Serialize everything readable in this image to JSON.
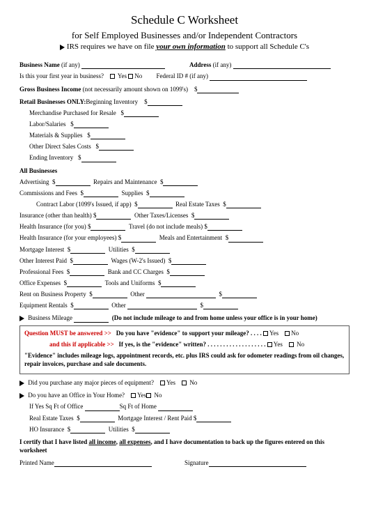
{
  "header": {
    "title": "Schedule C Worksheet",
    "subtitle": "for Self Employed Businesses and/or Independent Contractors",
    "irs_pre": "IRS requires we have on file ",
    "irs_emph": "your own information",
    "irs_post": " to support all Schedule C's"
  },
  "labels": {
    "business_name": "Business Name",
    "if_any": " (if any)",
    "address": "Address",
    "first_year": "Is this your first year in business?",
    "yes": "Yes",
    "no": "No",
    "federal_id": "Federal ID # (if any)",
    "gross_income": "Gross Business Income",
    "gross_income_note": " (not necessarily amount shown on 1099's)",
    "retail_only": "Retail Businesses ONLY:",
    "beginning_inv": "Beginning Inventory",
    "merch_resale": "Merchandise Purchased for Resale",
    "labor_salaries": "Labor/Salaries",
    "materials_supplies": "Materials & Supplies",
    "other_direct": "Other Direct Sales Costs",
    "ending_inv": "Ending Inventory",
    "all_businesses": "All Businesses",
    "advertising": "Advertising",
    "repairs": "Repairs and Maintenance",
    "commissions": "Commissions and Fees",
    "supplies": "Supplies",
    "contract_labor": "Contract Labor (1099's Issued, if app)",
    "real_estate_taxes": "Real Estate Taxes",
    "insurance_other": "Insurance (other than health)",
    "other_taxes": "Other Taxes/Licenses",
    "health_ins_you": "Health Insurance (for you)",
    "travel": "Travel (do not include meals)",
    "health_ins_emp": "Health Insurance (for your employees)",
    "meals_ent": "Meals and Entertainment",
    "mortgage_interest": "Mortgage Interest",
    "utilities": "Utilities",
    "other_interest": "Other Interest Paid",
    "wages": "Wages (W-2's Issued)",
    "professional_fees": "Professional Fees",
    "bank_cc": "Bank and CC Charges",
    "office_expenses": "Office Expenses",
    "tools_uniforms": "Tools and Uniforms",
    "rent_biz_property": "Rent on Business Property",
    "other": "Other",
    "equipment_rentals": "Equipment Rentals",
    "business_mileage": "Business Mileage",
    "mileage_note": "(Do not include mileage to and from home unless your office is in your home)",
    "q_must_pre": "Question MUST be answered >>",
    "q_evidence": "Do you have \"evidence\" to support your mileage? . .   . .",
    "and_if_pre": "and this if applicable >>",
    "q_written": "If yes, is the \"evidence\" written? . . . .  . . . . . . . . . . . . . . .",
    "evidence_note": "\"Evidence\" includes mileage logs, appointment records, etc. plus IRS could ask for odometer readings from oil changes, repair invoices, purchase and sale documents.",
    "major_equip": "Did you purchase any major pieces of equipment?",
    "office_home": "Do you have an Office in Your Home?",
    "if_yes_sqft_office": "If Yes  Sq Ft of Office",
    "sqft_home": "Sq Ft of Home",
    "re_taxes2": "Real Estate Taxes",
    "mort_rent": "Mortgage Interest / Rent Paid",
    "ho_insurance": "HO Insurance",
    "certify_pre": "I certify that I have listed ",
    "certify_income": "all income",
    "certify_mid": ", ",
    "certify_expenses": "all expenses",
    "certify_post": ", and I have documentation to back up the figures entered on this worksheet",
    "printed_name": "Printed Name",
    "signature": "Signature",
    "dollar": "$"
  }
}
